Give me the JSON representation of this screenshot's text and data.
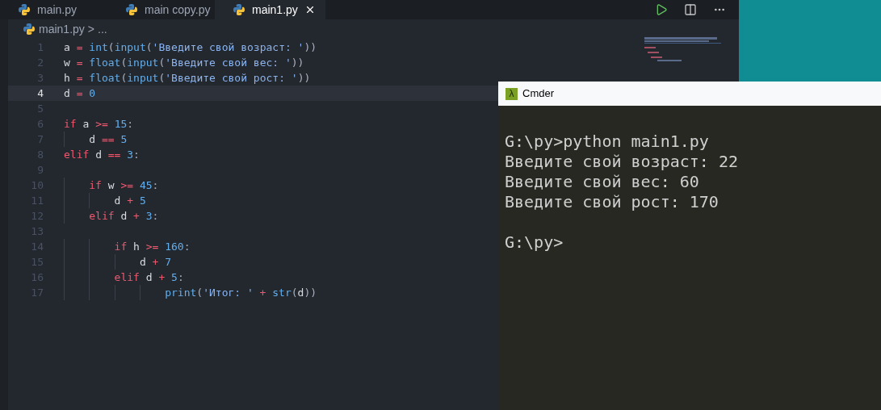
{
  "tabs": [
    {
      "label": "main.py",
      "selected": false
    },
    {
      "label": "main copy.py",
      "selected": false
    },
    {
      "label": "main1.py",
      "selected": true
    }
  ],
  "breadcrumb": {
    "file": "main1.py",
    "separator": ">",
    "more": "..."
  },
  "editor": {
    "lines": [
      {
        "number": "1",
        "active": false,
        "tokens": [
          {
            "kind": "id",
            "text": "a "
          },
          {
            "kind": "op",
            "text": "= "
          },
          {
            "kind": "fn",
            "text": "int"
          },
          {
            "kind": "punct",
            "text": "("
          },
          {
            "kind": "fn",
            "text": "input"
          },
          {
            "kind": "punct",
            "text": "("
          },
          {
            "kind": "str",
            "text": "'Введите свой возраст: '"
          },
          {
            "kind": "punct",
            "text": "))"
          }
        ]
      },
      {
        "number": "2",
        "active": false,
        "tokens": [
          {
            "kind": "id",
            "text": "w "
          },
          {
            "kind": "op",
            "text": "= "
          },
          {
            "kind": "fn",
            "text": "float"
          },
          {
            "kind": "punct",
            "text": "("
          },
          {
            "kind": "fn",
            "text": "input"
          },
          {
            "kind": "punct",
            "text": "("
          },
          {
            "kind": "str",
            "text": "'Введите свой вес: '"
          },
          {
            "kind": "punct",
            "text": "))"
          }
        ]
      },
      {
        "number": "3",
        "active": false,
        "tokens": [
          {
            "kind": "id",
            "text": "h "
          },
          {
            "kind": "op",
            "text": "= "
          },
          {
            "kind": "fn",
            "text": "float"
          },
          {
            "kind": "punct",
            "text": "("
          },
          {
            "kind": "fn",
            "text": "input"
          },
          {
            "kind": "punct",
            "text": "("
          },
          {
            "kind": "str",
            "text": "'Введите свой рост: '"
          },
          {
            "kind": "punct",
            "text": "))"
          }
        ]
      },
      {
        "number": "4",
        "active": true,
        "tokens": [
          {
            "kind": "id",
            "text": "d "
          },
          {
            "kind": "op",
            "text": "= "
          },
          {
            "kind": "num",
            "text": "0"
          }
        ]
      },
      {
        "number": "5",
        "active": false
      },
      {
        "number": "6",
        "active": false,
        "tokens": [
          {
            "kind": "kw",
            "text": "if "
          },
          {
            "kind": "id",
            "text": "a "
          },
          {
            "kind": "op",
            "text": ">= "
          },
          {
            "kind": "num",
            "text": "15"
          },
          {
            "kind": "punct",
            "text": ":"
          }
        ]
      },
      {
        "number": "7",
        "active": false,
        "tokens": [
          {
            "kind": "id",
            "text": "    d "
          },
          {
            "kind": "op",
            "text": "== "
          },
          {
            "kind": "num",
            "text": "5"
          }
        ]
      },
      {
        "number": "8",
        "active": false,
        "tokens": [
          {
            "kind": "kw",
            "text": "elif "
          },
          {
            "kind": "id",
            "text": "d "
          },
          {
            "kind": "op",
            "text": "== "
          },
          {
            "kind": "num",
            "text": "3"
          },
          {
            "kind": "punct",
            "text": ":"
          }
        ]
      },
      {
        "number": "9",
        "active": false
      },
      {
        "number": "10",
        "active": false,
        "tokens": [
          {
            "kind": "kw",
            "text": "    if "
          },
          {
            "kind": "id",
            "text": "w "
          },
          {
            "kind": "op",
            "text": ">= "
          },
          {
            "kind": "num",
            "text": "45"
          },
          {
            "kind": "punct",
            "text": ":"
          }
        ]
      },
      {
        "number": "11",
        "active": false,
        "tokens": [
          {
            "kind": "id",
            "text": "        d "
          },
          {
            "kind": "op",
            "text": "+ "
          },
          {
            "kind": "num",
            "text": "5"
          }
        ]
      },
      {
        "number": "12",
        "active": false,
        "tokens": [
          {
            "kind": "kw",
            "text": "    elif "
          },
          {
            "kind": "id",
            "text": "d "
          },
          {
            "kind": "op",
            "text": "+ "
          },
          {
            "kind": "num",
            "text": "3"
          },
          {
            "kind": "punct",
            "text": ":"
          }
        ]
      },
      {
        "number": "13",
        "active": false
      },
      {
        "number": "14",
        "active": false,
        "tokens": [
          {
            "kind": "kw",
            "text": "        if "
          },
          {
            "kind": "id",
            "text": "h "
          },
          {
            "kind": "op",
            "text": ">= "
          },
          {
            "kind": "num",
            "text": "160"
          },
          {
            "kind": "punct",
            "text": ":"
          }
        ]
      },
      {
        "number": "15",
        "active": false,
        "tokens": [
          {
            "kind": "id",
            "text": "            d "
          },
          {
            "kind": "op",
            "text": "+ "
          },
          {
            "kind": "num",
            "text": "7"
          }
        ]
      },
      {
        "number": "16",
        "active": false,
        "tokens": [
          {
            "kind": "kw",
            "text": "        elif "
          },
          {
            "kind": "id",
            "text": "d "
          },
          {
            "kind": "op",
            "text": "+ "
          },
          {
            "kind": "num",
            "text": "5"
          },
          {
            "kind": "punct",
            "text": ":"
          }
        ]
      },
      {
        "number": "17",
        "active": false,
        "tokens": [
          {
            "kind": "fn",
            "text": "                print"
          },
          {
            "kind": "punct",
            "text": "("
          },
          {
            "kind": "str",
            "text": "'Итог: '"
          },
          {
            "kind": "op",
            "text": " + "
          },
          {
            "kind": "fn",
            "text": "str"
          },
          {
            "kind": "punct",
            "text": "("
          },
          {
            "kind": "id",
            "text": "d"
          },
          {
            "kind": "punct",
            "text": "))"
          }
        ]
      }
    ]
  },
  "terminal": {
    "icon": "λ",
    "title": "Cmder",
    "blocks": [
      [
        "G:\\py>python main1.py",
        "Введите свой возраст: 22",
        "Введите свой вес: 60",
        "Введите свой рост: 170"
      ],
      [
        "G:\\py>"
      ]
    ]
  }
}
